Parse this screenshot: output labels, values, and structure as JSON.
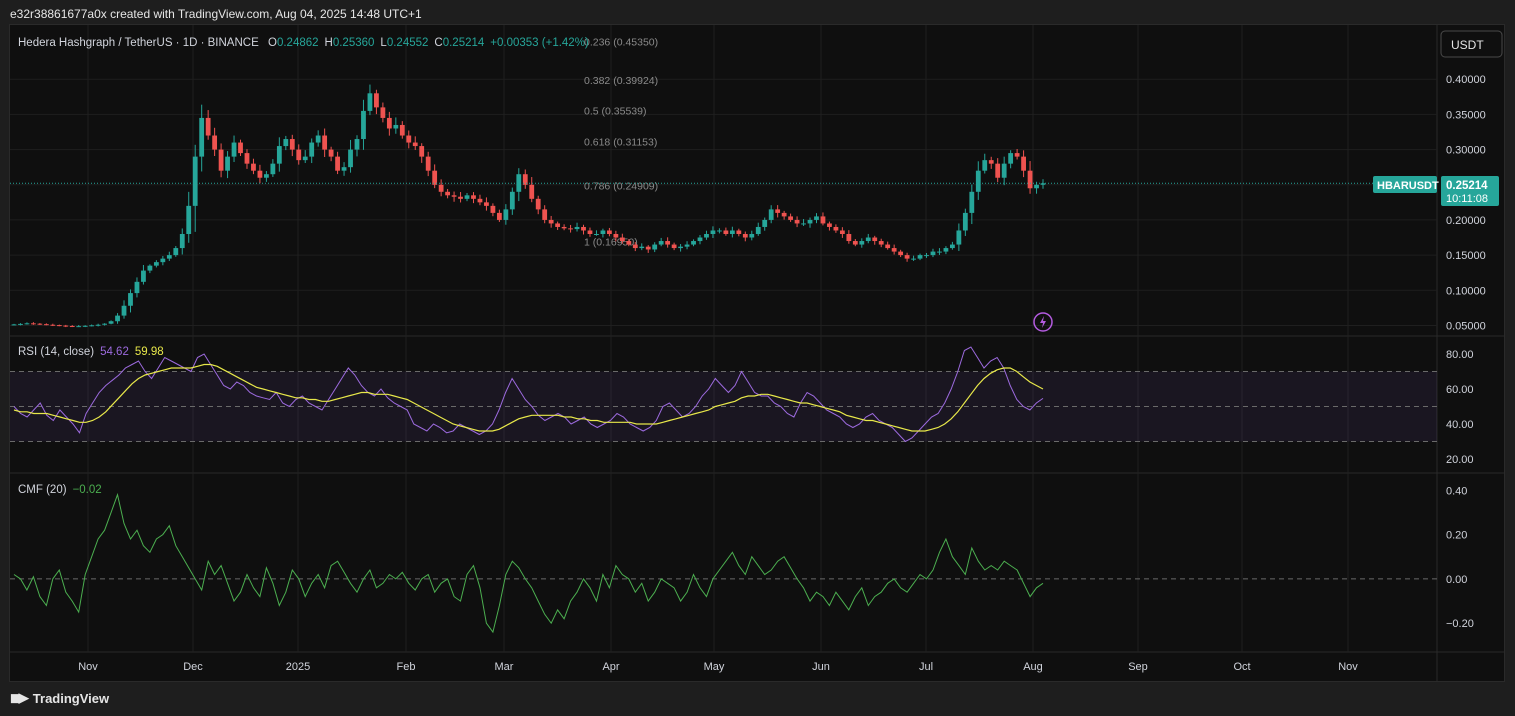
{
  "caption": "e32r38861677a0x created with TradingView.com, Aug 04, 2025 14:48 UTC+1",
  "brand": "TradingView",
  "colors": {
    "up": "#26a69a",
    "down": "#ef5350",
    "rsi": "#9c6ade",
    "rsi_ma": "#e8e84a",
    "cmf": "#4caf50",
    "grid": "#1f1f1f",
    "text": "#d1d4dc"
  },
  "header": {
    "symbol": "Hedera Hashgraph / TetherUS · 1D · BINANCE",
    "o_label": "O",
    "o": "0.24862",
    "h_label": "H",
    "h": "0.25360",
    "l_label": "L",
    "l": "0.24552",
    "c_label": "C",
    "c": "0.25214",
    "change": "+0.00353 (+1.42%)"
  },
  "currency_button": "USDT",
  "price_tag": {
    "symbol": "HBARUSDT",
    "price": "0.25214",
    "countdown": "10:11:08"
  },
  "fib_levels": [
    {
      "label": "0.236 (0.45350)",
      "value": 0.4535
    },
    {
      "label": "0.382 (0.39924)",
      "value": 0.39924
    },
    {
      "label": "0.5 (0.35539)",
      "value": 0.35539
    },
    {
      "label": "0.618 (0.31153)",
      "value": 0.31153
    },
    {
      "label": "0.786 (0.24909)",
      "value": 0.24909
    },
    {
      "label": "1 (0.16950)",
      "value": 0.1695
    }
  ],
  "rsi_legend": {
    "name": "RSI (14, close)",
    "value": "54.62",
    "ma_value": "59.98"
  },
  "cmf_legend": {
    "name": "CMF (20)",
    "value": "−0.02"
  },
  "chart_data": [
    {
      "type": "candlestick",
      "title": "Hedera Hashgraph / TetherUS · 1D · BINANCE",
      "x_ticks": [
        "Nov",
        "Dec",
        "2025",
        "Feb",
        "Mar",
        "Apr",
        "May",
        "Jun",
        "Jul",
        "Aug",
        "Sep",
        "Oct",
        "Nov"
      ],
      "y_ticks": [
        "0.40000",
        "0.35000",
        "0.30000",
        "0.25000",
        "0.20000",
        "0.15000",
        "0.10000",
        "0.05000"
      ],
      "ylim": [
        0.035,
        0.47
      ],
      "last_close": 0.25214,
      "series": [
        {
          "name": "HBARUSDT",
          "values": [
            0.0515,
            0.0522,
            0.053,
            0.0525,
            0.0518,
            0.051,
            0.0505,
            0.0498,
            0.0492,
            0.0488,
            0.049,
            0.0495,
            0.0502,
            0.051,
            0.0525,
            0.056,
            0.064,
            0.078,
            0.096,
            0.112,
            0.128,
            0.135,
            0.14,
            0.145,
            0.15,
            0.16,
            0.18,
            0.22,
            0.29,
            0.345,
            0.32,
            0.3,
            0.27,
            0.29,
            0.31,
            0.295,
            0.28,
            0.27,
            0.26,
            0.265,
            0.28,
            0.305,
            0.315,
            0.3,
            0.285,
            0.29,
            0.31,
            0.32,
            0.3,
            0.29,
            0.27,
            0.275,
            0.3,
            0.315,
            0.355,
            0.38,
            0.36,
            0.345,
            0.33,
            0.335,
            0.32,
            0.31,
            0.305,
            0.29,
            0.27,
            0.25,
            0.24,
            0.235,
            0.233,
            0.23,
            0.235,
            0.23,
            0.225,
            0.22,
            0.21,
            0.2,
            0.215,
            0.24,
            0.265,
            0.25,
            0.23,
            0.215,
            0.2,
            0.195,
            0.19,
            0.188,
            0.187,
            0.19,
            0.185,
            0.18,
            0.18,
            0.185,
            0.18,
            0.175,
            0.17,
            0.165,
            0.16,
            0.162,
            0.158,
            0.165,
            0.17,
            0.165,
            0.16,
            0.162,
            0.165,
            0.17,
            0.175,
            0.18,
            0.185,
            0.185,
            0.18,
            0.185,
            0.18,
            0.175,
            0.18,
            0.19,
            0.2,
            0.215,
            0.21,
            0.205,
            0.2,
            0.195,
            0.195,
            0.2,
            0.205,
            0.195,
            0.19,
            0.185,
            0.18,
            0.17,
            0.165,
            0.17,
            0.175,
            0.17,
            0.165,
            0.16,
            0.155,
            0.15,
            0.145,
            0.145,
            0.15,
            0.15,
            0.155,
            0.155,
            0.16,
            0.165,
            0.185,
            0.21,
            0.24,
            0.27,
            0.285,
            0.28,
            0.26,
            0.28,
            0.295,
            0.29,
            0.27,
            0.245,
            0.25,
            0.2521
          ]
        }
      ]
    },
    {
      "type": "line",
      "title": "RSI (14, close)",
      "y_ticks": [
        "80.00",
        "60.00",
        "40.00",
        "20.00"
      ],
      "ylim": [
        12,
        88
      ],
      "bands": [
        70,
        50,
        30
      ],
      "series": [
        {
          "name": "RSI",
          "values": [
            50,
            46,
            44,
            48,
            52,
            45,
            42,
            48,
            44,
            40,
            35,
            46,
            52,
            58,
            62,
            65,
            68,
            72,
            74,
            76,
            70,
            66,
            72,
            78,
            76,
            74,
            72,
            70,
            78,
            80,
            74,
            68,
            62,
            60,
            64,
            62,
            58,
            56,
            55,
            54,
            58,
            52,
            50,
            54,
            56,
            52,
            50,
            48,
            54,
            60,
            66,
            72,
            68,
            62,
            58,
            56,
            60,
            55,
            52,
            50,
            48,
            40,
            38,
            36,
            40,
            38,
            35,
            36,
            40,
            38,
            36,
            34,
            36,
            40,
            48,
            58,
            66,
            60,
            54,
            50,
            45,
            42,
            44,
            46,
            44,
            40,
            42,
            44,
            40,
            38,
            40,
            42,
            46,
            44,
            40,
            38,
            36,
            38,
            42,
            50,
            52,
            48,
            44,
            46,
            50,
            56,
            60,
            66,
            62,
            58,
            62,
            70,
            64,
            58,
            56,
            56,
            52,
            50,
            46,
            44,
            52,
            58,
            56,
            52,
            48,
            46,
            44,
            40,
            38,
            40,
            44,
            46,
            42,
            40,
            38,
            34,
            30,
            32,
            36,
            40,
            44,
            46,
            52,
            60,
            70,
            82,
            84,
            78,
            72,
            76,
            78,
            72,
            62,
            54,
            50,
            48,
            52,
            54.62
          ]
        },
        {
          "name": "RSI-based MA",
          "values": [
            48,
            47,
            47,
            46,
            46,
            46,
            45,
            44,
            43,
            42,
            41,
            41,
            42,
            44,
            47,
            51,
            55,
            59,
            63,
            66,
            68,
            69,
            70,
            71,
            72,
            72,
            72,
            72,
            73,
            74,
            74,
            73,
            71,
            69,
            67,
            65,
            63,
            61,
            60,
            59,
            58,
            57,
            56,
            55,
            55,
            54,
            54,
            53,
            53,
            54,
            55,
            56,
            57,
            58,
            58,
            57,
            57,
            57,
            56,
            55,
            54,
            52,
            50,
            48,
            46,
            44,
            42,
            40,
            39,
            38,
            37,
            36,
            36,
            36,
            37,
            39,
            41,
            43,
            44,
            45,
            45,
            45,
            45,
            45,
            44,
            44,
            43,
            43,
            42,
            42,
            41,
            41,
            41,
            41,
            41,
            40,
            40,
            40,
            40,
            41,
            42,
            43,
            44,
            45,
            46,
            47,
            48,
            50,
            51,
            52,
            53,
            55,
            56,
            56,
            57,
            57,
            56,
            55,
            54,
            53,
            52,
            52,
            51,
            50,
            49,
            48,
            47,
            45,
            44,
            43,
            42,
            42,
            41,
            40,
            39,
            38,
            37,
            36,
            36,
            36,
            37,
            38,
            40,
            43,
            47,
            52,
            57,
            62,
            66,
            69,
            71,
            72,
            72,
            70,
            67,
            64,
            62,
            59.98
          ]
        }
      ]
    },
    {
      "type": "line",
      "title": "CMF (20)",
      "y_ticks": [
        "0.40",
        "0.20",
        "0.00",
        "−0.20"
      ],
      "ylim": [
        -0.33,
        0.46
      ],
      "zero_line": 0,
      "series": [
        {
          "name": "CMF",
          "values": [
            0.02,
            0.0,
            -0.05,
            0.01,
            -0.08,
            -0.12,
            0.0,
            0.04,
            -0.06,
            -0.1,
            -0.15,
            0.02,
            0.1,
            0.18,
            0.22,
            0.3,
            0.38,
            0.25,
            0.18,
            0.22,
            0.15,
            0.12,
            0.18,
            0.2,
            0.24,
            0.15,
            0.1,
            0.05,
            0.0,
            -0.05,
            0.08,
            0.02,
            0.06,
            -0.02,
            -0.1,
            -0.06,
            0.02,
            -0.04,
            -0.08,
            0.05,
            -0.02,
            -0.12,
            -0.06,
            0.04,
            0.0,
            -0.08,
            -0.02,
            0.02,
            -0.04,
            0.06,
            0.08,
            0.03,
            -0.02,
            -0.06,
            0.0,
            0.04,
            -0.04,
            -0.02,
            0.02,
            0.0,
            0.03,
            -0.02,
            -0.05,
            0.0,
            0.02,
            -0.06,
            -0.02,
            0.0,
            -0.08,
            -0.1,
            0.02,
            0.06,
            -0.04,
            -0.2,
            -0.24,
            -0.12,
            0.02,
            0.08,
            0.05,
            0.0,
            -0.04,
            -0.1,
            -0.16,
            -0.2,
            -0.14,
            -0.18,
            -0.1,
            -0.06,
            0.0,
            -0.04,
            -0.1,
            0.02,
            -0.04,
            0.06,
            0.02,
            0.0,
            -0.06,
            -0.02,
            -0.1,
            -0.06,
            0.0,
            -0.02,
            -0.04,
            -0.1,
            -0.06,
            0.02,
            -0.04,
            -0.08,
            0.0,
            0.04,
            0.08,
            0.12,
            0.06,
            0.02,
            0.1,
            0.06,
            0.02,
            0.04,
            0.08,
            0.1,
            0.05,
            0.0,
            -0.04,
            -0.1,
            -0.06,
            -0.08,
            -0.12,
            -0.06,
            -0.1,
            -0.14,
            -0.08,
            -0.04,
            -0.12,
            -0.08,
            -0.06,
            -0.02,
            0.0,
            -0.04,
            -0.06,
            -0.02,
            0.02,
            0.0,
            0.04,
            0.12,
            0.18,
            0.1,
            0.06,
            0.02,
            0.14,
            0.08,
            0.04,
            0.06,
            0.04,
            0.08,
            0.06,
            0.04,
            -0.02,
            -0.08,
            -0.04,
            -0.02
          ]
        }
      ]
    }
  ]
}
